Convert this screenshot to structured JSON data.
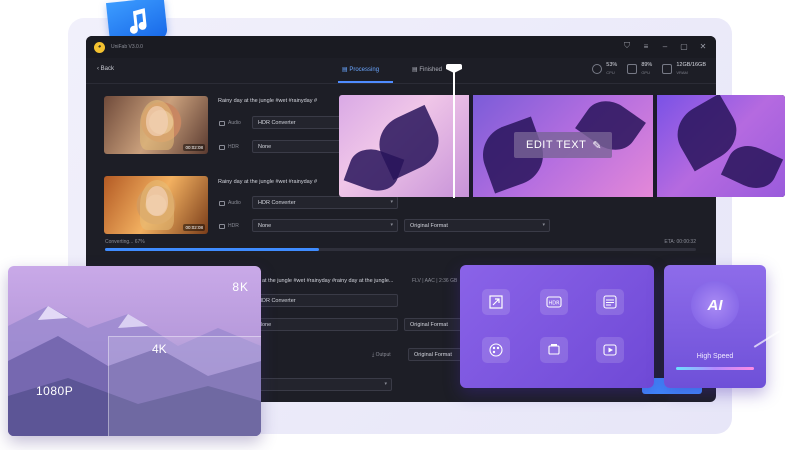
{
  "app": {
    "title": "UniFab V3.0.0",
    "back_label": "Back",
    "tabs": [
      {
        "label": "Processing",
        "active": true
      },
      {
        "label": "Finished",
        "active": false
      }
    ],
    "stats": [
      {
        "value": "53%",
        "label": "CPU"
      },
      {
        "value": "89%",
        "label": "GPU"
      },
      {
        "value": "12GB/16GB",
        "label": "VRAM"
      }
    ]
  },
  "files": [
    {
      "title": "Rainy day at the jungle #wet #rainyday #",
      "duration": "00:02:08",
      "audio_label": "Audio",
      "audio_value": "HDR Converter",
      "hdr_label": "HDR",
      "hdr_value": "None"
    },
    {
      "title": "Rainy day at the jungle #wet #rainyday #",
      "duration": "00:02:08",
      "audio_label": "Audio",
      "audio_value": "HDR Converter",
      "hdr_label": "HDR",
      "hdr_value": "None",
      "format_value": "Original Format",
      "progress_label": "Converting... 67%",
      "progress_percent": 67,
      "eta": "ETA: 00:00:32"
    },
    {
      "title": "Rainy day at the jungle #wet #rainyday #rainy day at the jungle...",
      "meta": "FLV | AAC | 2:36 GB",
      "audio_value": "HDR Converter",
      "hdr_value": "None",
      "format_value": "Original Format"
    }
  ],
  "output": {
    "label": "Output",
    "format_value": "Original Format"
  },
  "overlay": {
    "edit_text_label": "EDIT TEXT"
  },
  "resolution_card": {
    "label_8k": "8K",
    "label_4k": "4K",
    "label_1080p": "1080P"
  },
  "ai_card": {
    "badge": "AI",
    "label": "High Speed"
  },
  "colors": {
    "accent": "#3f8cff",
    "app_bg": "#1d1e26",
    "card_purple": "#7b56e0"
  }
}
